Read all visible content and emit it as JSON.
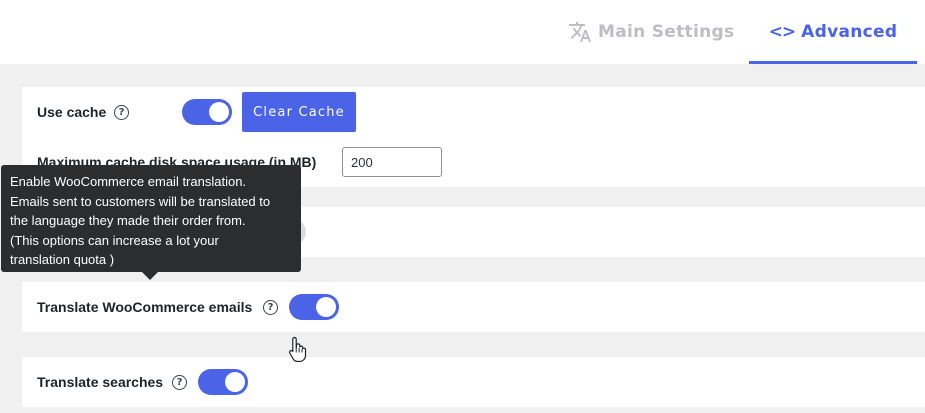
{
  "tabs": {
    "main_settings": {
      "label": "Main Settings",
      "icon": "translate-icon"
    },
    "advanced": {
      "label": "Advanced",
      "icon": "code-icon",
      "active": true
    }
  },
  "cache": {
    "label": "Use cache",
    "enabled": true,
    "clear_button": "Clear Cache",
    "max_disk_label": "Maximum cache disk space usage (in MB)",
    "max_disk_value": "200"
  },
  "woocommerce": {
    "label": "Translate WooCommerce emails",
    "enabled": true
  },
  "searches": {
    "label": "Translate searches",
    "enabled": true
  },
  "tooltip": {
    "lines": [
      "Enable WooCommerce email translation.",
      "Emails sent to customers will be translated to",
      "the language they made their order from.",
      "(This options can increase a lot your",
      "translation quota )"
    ]
  },
  "colors": {
    "accent": "#4a63e7",
    "tab_inactive": "#bdbdc2",
    "background": "#f0f0f1",
    "tooltip_bg": "#2c2d2f"
  }
}
